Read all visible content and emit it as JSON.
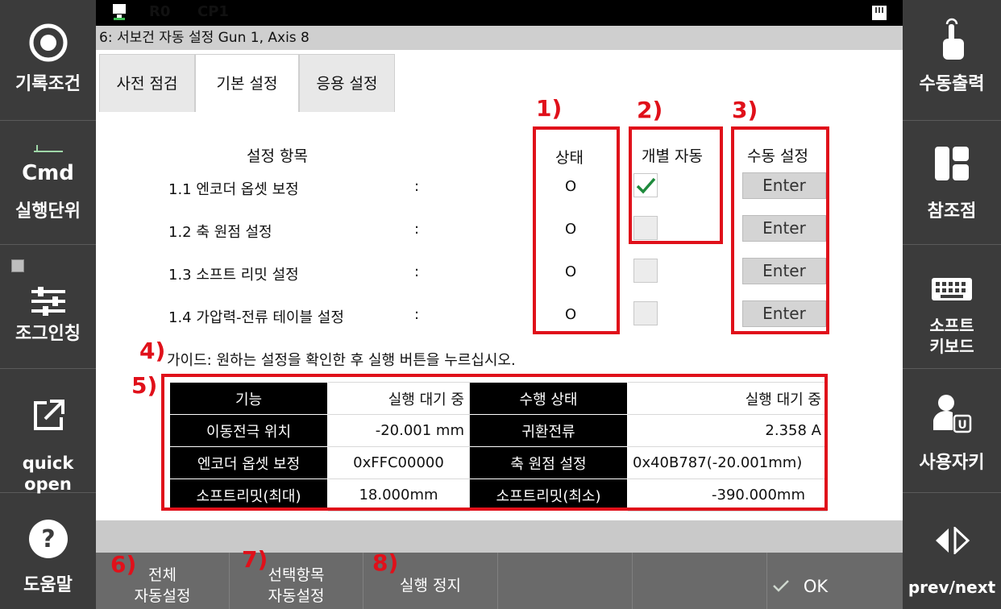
{
  "status_bar": {
    "robot": "R0",
    "program": "CP1"
  },
  "title": "6: 서보건 자동 설정 Gun 1, Axis 8",
  "tabs": [
    "사전 점검",
    "기본 설정",
    "응용 설정"
  ],
  "left_panel": [
    {
      "label": "기록조건",
      "icon": "target-icon"
    },
    {
      "label": "실행단위",
      "icon": "cmd-icon",
      "icon_text": "Cmd"
    },
    {
      "label": "조그인칭",
      "icon": "sliders-icon"
    },
    {
      "label": "quick open",
      "icon": "open-external-icon"
    },
    {
      "label": "도움말",
      "icon": "help-icon"
    }
  ],
  "right_panel": [
    {
      "label": "수동출력",
      "icon": "touch-hand-icon"
    },
    {
      "label": "참조점",
      "icon": "layout-icon"
    },
    {
      "label_line1": "소프트",
      "label_line2": "키보드",
      "icon": "keyboard-icon"
    },
    {
      "label": "사용자키",
      "icon": "user-key-icon"
    },
    {
      "label": "prev/next",
      "icon": "prev-next-icon"
    }
  ],
  "settings": {
    "header_item": "설정 항목",
    "header_status": "상태",
    "header_auto": "개별 자동",
    "header_manual": "수동 설정",
    "rows": [
      {
        "item": "1.1 엔코더 옵셋 보정",
        "sep": ":",
        "status": "O",
        "checked": true,
        "button": "Enter"
      },
      {
        "item": "1.2 축 원점 설정",
        "sep": ":",
        "status": "O",
        "checked": false,
        "button": "Enter"
      },
      {
        "item": "1.3 소프트 리밋 설정",
        "sep": ":",
        "status": "O",
        "checked": false,
        "button": "Enter"
      },
      {
        "item": "1.4 가압력-전류 테이블 설정",
        "sep": ":",
        "status": "O",
        "checked": false,
        "button": "Enter"
      }
    ]
  },
  "guide": "가이드: 원하는 설정을 확인한 후 실행 버튼을 누르십시오.",
  "info_table": [
    {
      "k1": "기능",
      "v1": "실행 대기 중",
      "k2": "수행 상태",
      "v2": "실행 대기 중"
    },
    {
      "k1": "이동전극 위치",
      "v1": "-20.001 mm",
      "k2": "귀환전류",
      "v2": "2.358 A"
    },
    {
      "k1": "엔코더 옵셋 보정",
      "v1": "0xFFC00000",
      "k2": "축 원점 설정",
      "v2": "0x40B787(-20.001mm)"
    },
    {
      "k1": "소프트리밋(최대)",
      "v1": "18.000mm",
      "k2": "소프트리밋(최소)",
      "v2": "-390.000mm"
    }
  ],
  "bottom_buttons": [
    {
      "line1": "전체",
      "line2": "자동설정"
    },
    {
      "line1": "선택항목",
      "line2": "자동설정"
    },
    {
      "line1": "실행 정지",
      "line2": ""
    },
    {
      "line1": "",
      "line2": ""
    },
    {
      "line1": "",
      "line2": ""
    },
    {
      "line1": "OK",
      "line2": ""
    }
  ],
  "annotations": [
    "1)",
    "2)",
    "3)",
    "4)",
    "5)",
    "6)",
    "7)",
    "8)"
  ],
  "colors": {
    "annotation_red": "#e0101a",
    "check_green": "#1e8a3c"
  }
}
